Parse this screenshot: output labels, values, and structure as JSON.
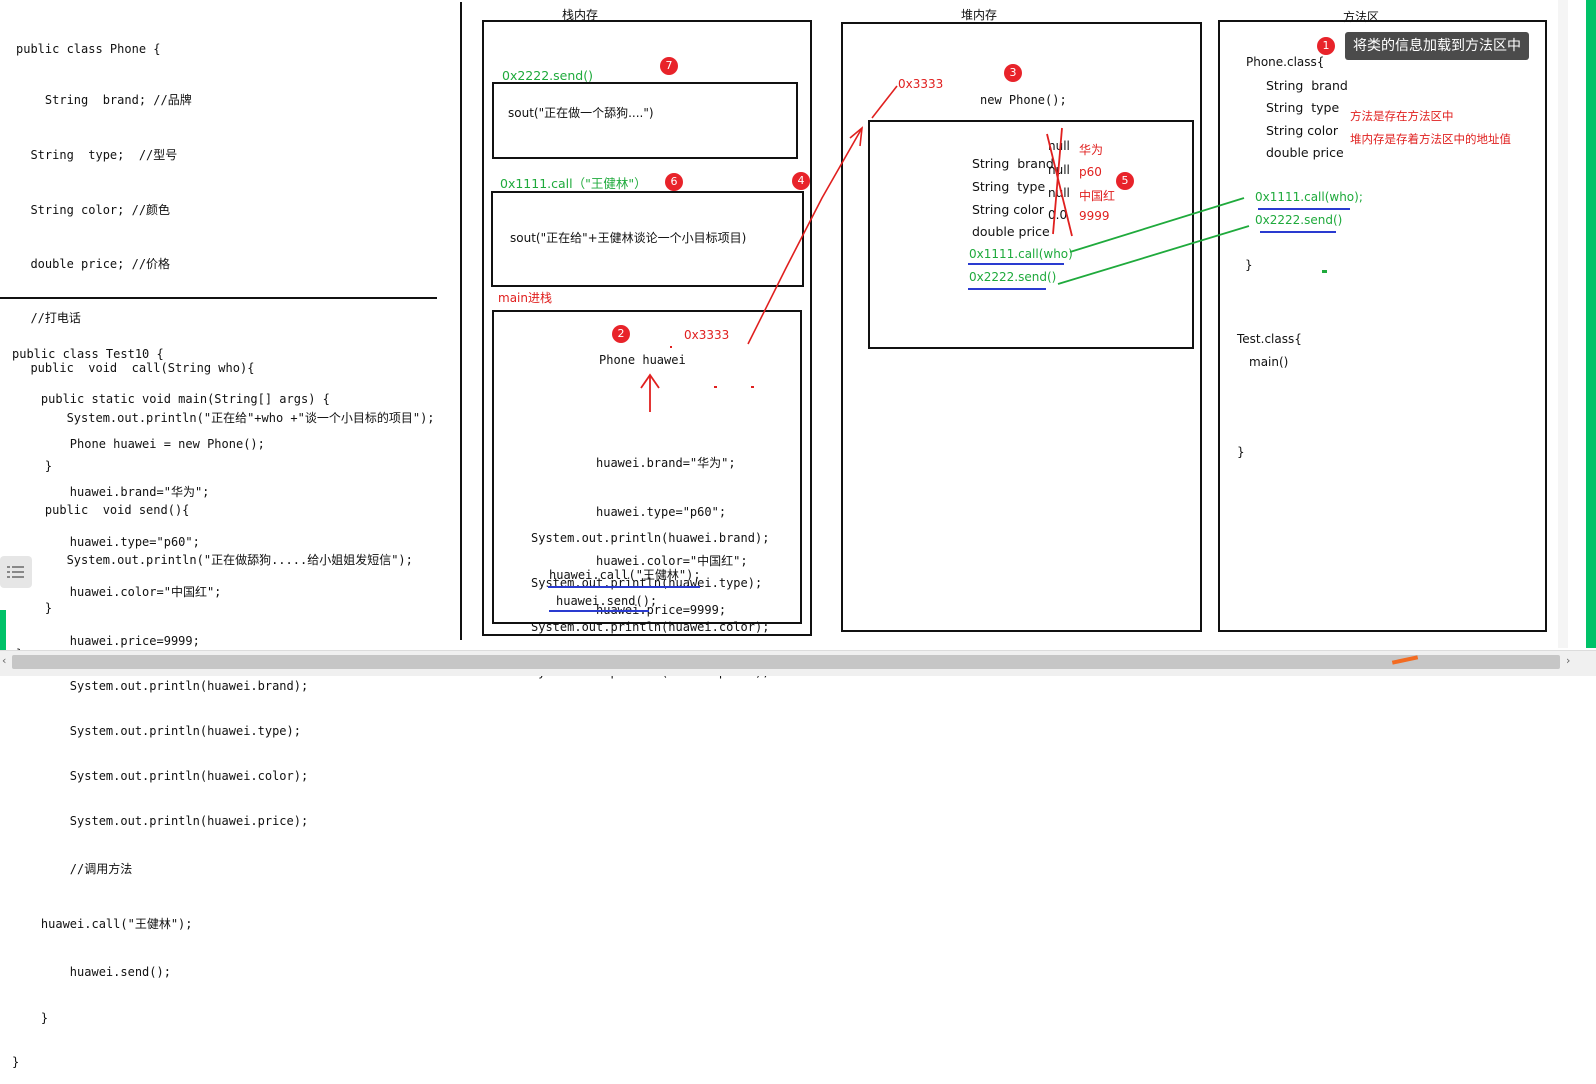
{
  "phone_class_code": [
    "public class Phone {",
    "    String  brand; //品牌",
    "  String  type;  //型号",
    "  String color; //颜色",
    "  double price; //价格",
    "  //打电话",
    "  public  void  call(String who){",
    "       System.out.println(\"正在给\"+who +\"谈一个小目标的项目\");",
    "    }",
    "    public  void send(){",
    "       System.out.println(\"正在做舔狗.....给小姐姐发短信\");",
    "    }",
    "}"
  ],
  "test10_code": [
    "public class Test10 {",
    "    public static void main(String[] args) {",
    "        Phone huawei = new Phone();",
    "        huawei.brand=\"华为\";",
    "        huawei.type=\"p60\";",
    "        huawei.color=\"中国红\";",
    "        huawei.price=9999;",
    "        System.out.println(huawei.brand);",
    "        System.out.println(huawei.type);",
    "        System.out.println(huawei.color);",
    "        System.out.println(huawei.price);",
    "        //调用方法",
    "    huawei.call(\"王健林\");",
    "        huawei.send();",
    "    }",
    "}"
  ],
  "stack": {
    "title": "栈内存",
    "frame_send_label": "0x2222.send()",
    "frame_send_code": "sout(\"正在做一个舔狗....\")",
    "frame_call_label": "0x1111.call（\"王健林\"）",
    "frame_call_code": "sout(\"正在给\"+王健林谈论一个小目标项目)",
    "main_label": "main进栈",
    "main_addr": "0x3333",
    "main_var": "Phone huawei",
    "main_code": [
      "huawei.brand=\"华为\";",
      "huawei.type=\"p60\";",
      "huawei.color=\"中国红\";",
      "huawei.price=9999;"
    ],
    "main_println": [
      "System.out.println(huawei.brand);",
      "System.out.println(huawei.type);",
      "System.out.println(huawei.color);",
      "System.out.println(huawei.price);"
    ],
    "main_call": "huawei.call(\"王健林\");",
    "main_send": "huawei.send();"
  },
  "heap": {
    "title": "堆内存",
    "addr": "0x3333",
    "new_phone": "new Phone();",
    "fields": [
      {
        "name": "String  brand",
        "default": "null",
        "value": "华为"
      },
      {
        "name": "String  type",
        "default": "null",
        "value": "p60"
      },
      {
        "name": "String color",
        "default": "null",
        "value": "中国红"
      },
      {
        "name": "double price",
        "default": "0.0",
        "value": "9999"
      }
    ],
    "method_call": "0x1111.call(who)",
    "method_send": "0x2222.send()"
  },
  "method_area": {
    "title": "方法区",
    "tooltip": "将类的信息加载到方法区中",
    "phone_class_open": "Phone.class{",
    "phone_fields": [
      "String  brand",
      "String  type",
      "String color",
      "double price"
    ],
    "note1": "方法是存在方法区中",
    "note2": "堆内存是存着方法区中的地址值",
    "method_call": "0x1111.call(who);",
    "method_send": "0x2222.send()",
    "close_brace": "}",
    "test_class_open": "Test.class{",
    "test_main": "main()",
    "test_close": "}"
  },
  "badges": [
    "1",
    "2",
    "3",
    "4",
    "5",
    "6",
    "7"
  ],
  "colors": {
    "red": "#e0201f",
    "green": "#1faa3c",
    "blue_underline": "#2a3bd0"
  }
}
